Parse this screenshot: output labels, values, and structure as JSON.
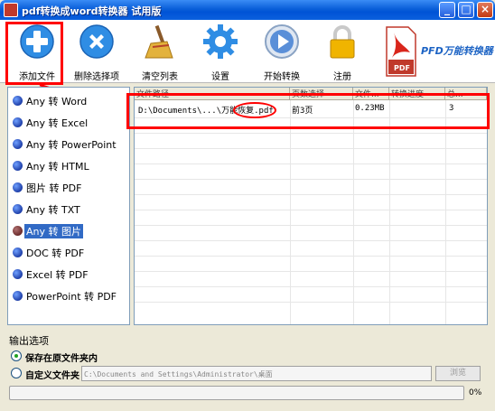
{
  "window": {
    "title": "pdf转换成word转换器 试用版",
    "minimize": "_",
    "maximize": "□",
    "close": "×"
  },
  "toolbar": {
    "buttons": [
      {
        "label": "添加文件",
        "icon": "add-icon",
        "color": "#2f8de4"
      },
      {
        "label": "删除选择项",
        "icon": "delete-icon",
        "color": "#2f8de4"
      },
      {
        "label": "清空列表",
        "icon": "broom-icon",
        "color": "#d9a22a"
      },
      {
        "label": "设置",
        "icon": "gear-icon",
        "color": "#2f8de4"
      },
      {
        "label": "开始转换",
        "icon": "play-icon",
        "color": "#5a8fd8"
      },
      {
        "label": "注册",
        "icon": "lock-icon",
        "color": "#f0b400"
      }
    ],
    "logo_text": "PFD万能转换器",
    "logo_icon": "pdf-document-icon"
  },
  "sidebar": {
    "items": [
      {
        "label": "Any 转 Word",
        "selected": false
      },
      {
        "label": "Any 转 Excel",
        "selected": false
      },
      {
        "label": "Any 转 PowerPoint",
        "selected": false
      },
      {
        "label": "Any 转 HTML",
        "selected": false
      },
      {
        "label": "图片 转 PDF",
        "selected": false
      },
      {
        "label": "Any 转 TXT",
        "selected": false
      },
      {
        "label": "Any 转 图片",
        "selected": true
      },
      {
        "label": "DOC 转 PDF",
        "selected": false
      },
      {
        "label": "Excel 转 PDF",
        "selected": false
      },
      {
        "label": "PowerPoint 转 PDF",
        "selected": false
      }
    ]
  },
  "file_table": {
    "columns": [
      "文件路径",
      "页数选择",
      "文件...",
      "转换进度",
      "总..."
    ],
    "rows": [
      {
        "path": "D:\\Documents\\...\\万能恢复.pdf",
        "pages": "前3页",
        "size": "0.23MB",
        "progress": "",
        "total": "3"
      }
    ]
  },
  "output": {
    "section_title": "输出选项",
    "option_same_folder": "保存在原文件夹内",
    "option_custom_folder": "自定义文件夹",
    "selected_option": "same_folder",
    "custom_path": "C:\\Documents and Settings\\Administrator\\桌面",
    "browse_label": "浏览",
    "progress_fraction": 0,
    "progress_text": "0%"
  },
  "colors": {
    "highlight": "#ff0000",
    "selection": "#316ac5",
    "progress": "#32c032"
  }
}
